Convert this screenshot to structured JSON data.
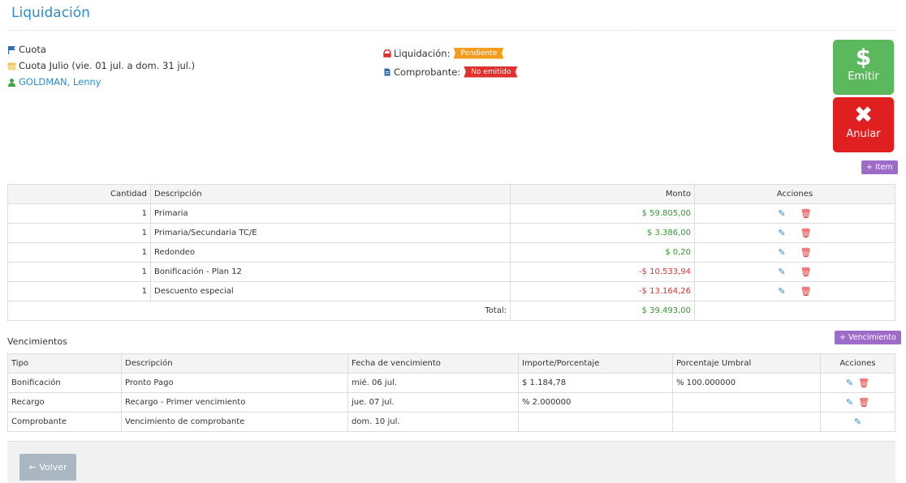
{
  "page": {
    "title": "Liquidación"
  },
  "info": {
    "tipo": "Cuota",
    "periodo": "Cuota Julio (vie. 01 jul. a dom. 31 jul.)",
    "persona": "GOLDMAN, Lenny",
    "liquidacion_label": "Liquidación:",
    "liquidacion_estado": "Pendiente",
    "comprobante_label": "Comprobante:",
    "comprobante_estado": "No emitido"
  },
  "actions": {
    "emitir": "Emitir",
    "emitir_glyph": "$",
    "anular": "Anular",
    "anular_glyph": "✖",
    "item": "+ Item",
    "vencimiento": "+ Vencimiento"
  },
  "items_table": {
    "headers": {
      "cantidad": "Cantidad",
      "descripcion": "Descripción",
      "monto": "Monto",
      "acciones": "Acciones"
    },
    "rows": [
      {
        "cantidad": "1",
        "descripcion": "Primaria",
        "monto": "$ 59.805,00"
      },
      {
        "cantidad": "1",
        "descripcion": "Primaria/Secundaria TC/E",
        "monto": "$ 3.386,00"
      },
      {
        "cantidad": "1",
        "descripcion": "Redondeo",
        "monto": "$ 0,20"
      },
      {
        "cantidad": "1",
        "descripcion": "Bonificación - Plan 12",
        "monto": "-$ 10.533,94"
      },
      {
        "cantidad": "1",
        "descripcion": "Descuento especial",
        "monto": "-$ 13.164,26"
      }
    ],
    "total_label": "Total:",
    "total": "$ 39.493,00"
  },
  "vencimientos": {
    "title": "Vencimientos",
    "headers": {
      "tipo": "Tipo",
      "descripcion": "Descripción",
      "fecha": "Fecha de vencimiento",
      "importe": "Importe/Porcentaje",
      "umbral": "Porcentaje Umbral",
      "acciones": "Acciones"
    },
    "rows": [
      {
        "tipo": "Bonificación",
        "descripcion": "Pronto Pago",
        "fecha": "mié. 06 jul.",
        "importe": "$ 1.184,78",
        "umbral": "% 100.000000"
      },
      {
        "tipo": "Recargo",
        "descripcion": "Recargo - Primer vencimiento",
        "fecha": "jue. 07 jul.",
        "importe": "% 2.000000",
        "umbral": ""
      },
      {
        "tipo": "Comprobante",
        "descripcion": "Vencimiento de comprobante",
        "fecha": "dom. 10 jul.",
        "importe": "",
        "umbral": ""
      }
    ]
  },
  "footer": {
    "volver": "← Volver"
  },
  "colors": {
    "accent": "#2f8cc7",
    "success": "#5cb85c",
    "danger": "#e02020",
    "purple": "#9d6cc8"
  }
}
